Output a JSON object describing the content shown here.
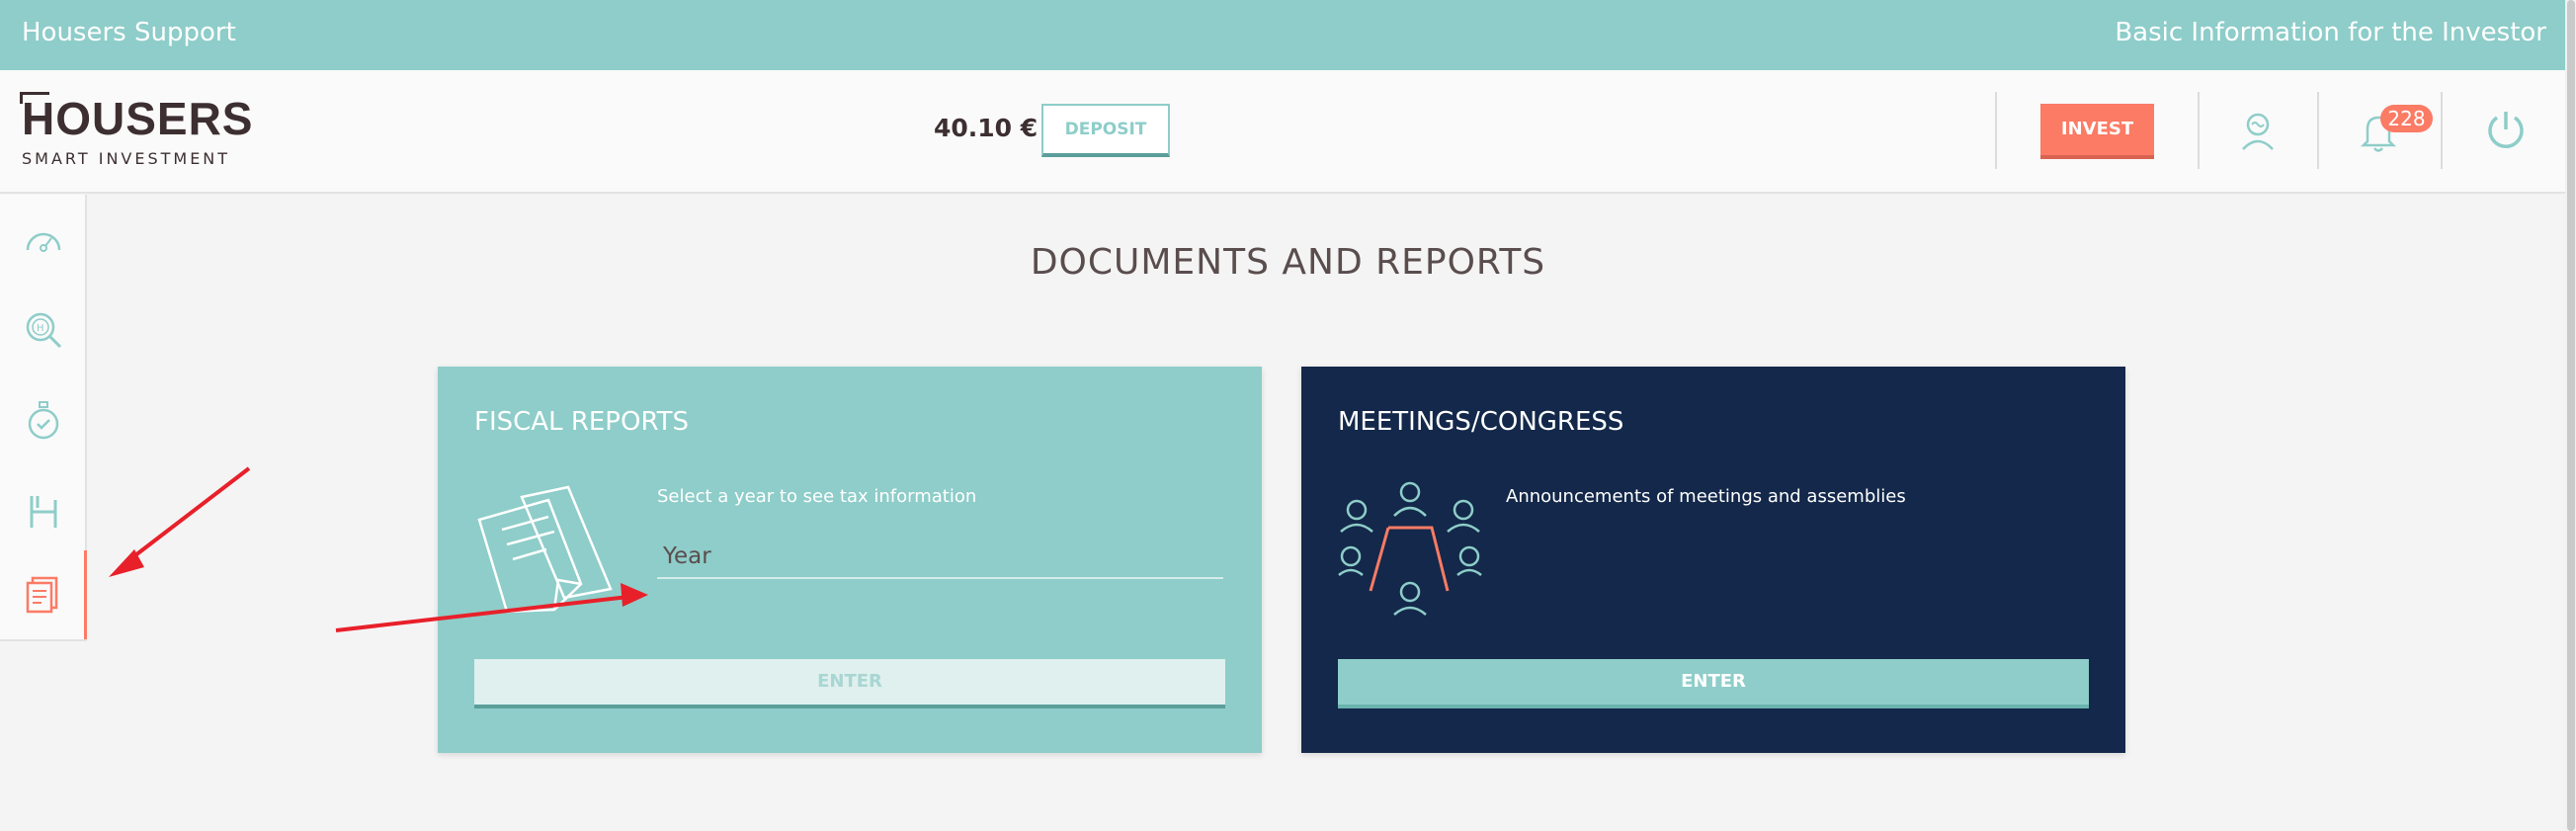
{
  "topbar": {
    "left_title": "Housers Support",
    "right_title": "Basic Information for the Investor"
  },
  "header": {
    "logo_brand": "HOUSERS",
    "logo_tagline": "SMART INVESTMENT",
    "balance": "40.10 €",
    "deposit_label": "DEPOSIT",
    "invest_label": "INVEST",
    "notification_count": "228"
  },
  "sidebar": {
    "items": [
      {
        "icon": "dashboard-gauge-icon"
      },
      {
        "icon": "search-properties-icon"
      },
      {
        "icon": "stopwatch-check-icon"
      },
      {
        "icon": "housers-h-icon"
      },
      {
        "icon": "documents-icon",
        "active": true
      }
    ]
  },
  "page": {
    "title": "DOCUMENTS AND REPORTS"
  },
  "cards": {
    "fiscal": {
      "title": "FISCAL REPORTS",
      "description": "Select a year to see tax information",
      "year_placeholder": "Year",
      "enter_label": "ENTER"
    },
    "meetings": {
      "title": "MEETINGS/CONGRESS",
      "description": "Announcements of meetings and assemblies",
      "enter_label": "ENTER"
    }
  },
  "colors": {
    "teal": "#8ecdc9",
    "coral": "#fb7b65",
    "navy": "#13284a",
    "annotation_arrow": "#e8202a"
  }
}
